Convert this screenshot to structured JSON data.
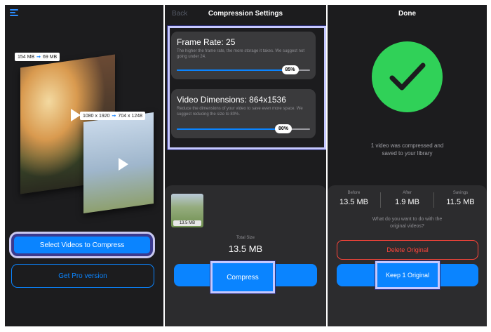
{
  "panel1": {
    "menu_icon": "menu-icon",
    "tag_top": {
      "from": "154 MB",
      "to": "69 MB"
    },
    "tag_bottom": {
      "from": "1080 x 1920",
      "to": "704 x 1248"
    },
    "select_button": "Select Videos to Compress",
    "pro_button": "Get Pro version"
  },
  "panel2": {
    "back": "Back",
    "title": "Compression Settings",
    "frame_rate": {
      "title": "Frame Rate: 25",
      "desc": "The higher the frame rate, the more storage it takes. We suggest not going under 24.",
      "value": "85%",
      "level": 0.85
    },
    "dimensions": {
      "title": "Video Dimensions: 864x1536",
      "desc": "Reduce the dimensions of your video to save even more space. We suggest reducing the size to 80%.",
      "value": "80%",
      "level": 0.8
    },
    "thumb_size": "13.5 MB",
    "total_label": "Total Size",
    "total_value": "13.5 MB",
    "compress_button": "Compress"
  },
  "panel3": {
    "title": "Done",
    "message_line1": "1 video was compressed and",
    "message_line2": "saved to your library",
    "stats": [
      {
        "label": "Before",
        "value": "13.5 MB"
      },
      {
        "label": "After",
        "value": "1.9 MB"
      },
      {
        "label": "Savings",
        "value": "11.5 MB"
      }
    ],
    "question_line1": "What do you want to do with the",
    "question_line2": "original videos?",
    "delete_button": "Delete Original",
    "keep_button": "Keep 1 Original"
  },
  "colors": {
    "accent": "#0a84ff",
    "success": "#30d158",
    "danger": "#ff453a",
    "highlight": "#c5c8ff"
  }
}
